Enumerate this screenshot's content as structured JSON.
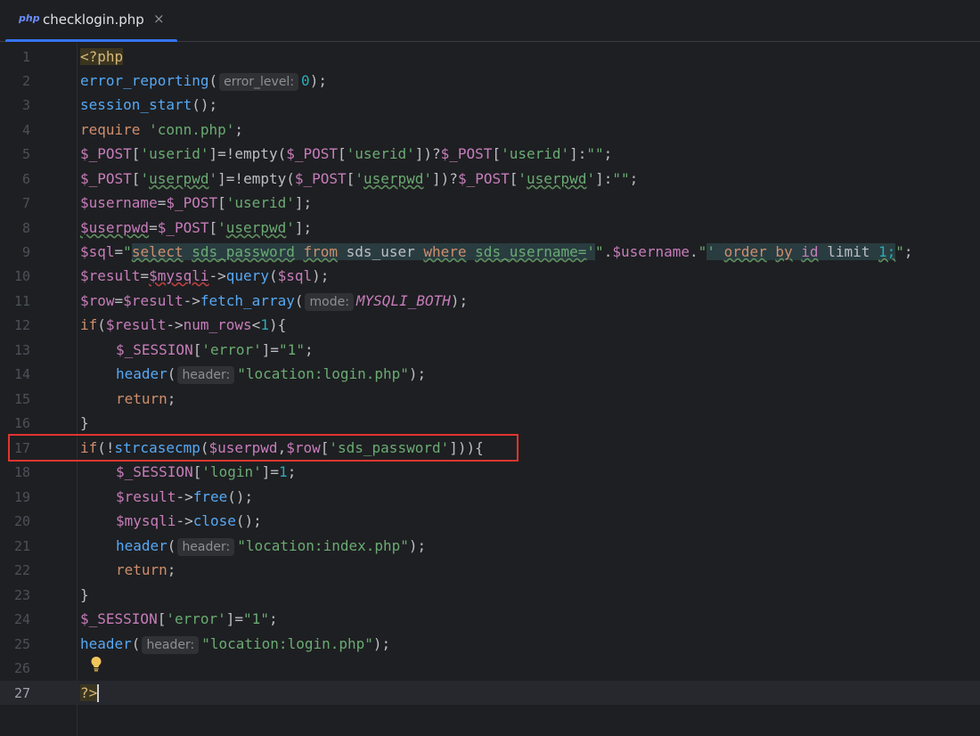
{
  "tab": {
    "icon_text": "php",
    "filename": "checklogin.php",
    "close_glyph": "×"
  },
  "hints": {
    "error_level": "error_level:",
    "mode": "mode:",
    "header": "header:"
  },
  "line_numbers": [
    "1",
    "2",
    "3",
    "4",
    "5",
    "6",
    "7",
    "8",
    "9",
    "10",
    "11",
    "12",
    "13",
    "14",
    "15",
    "16",
    "17",
    "18",
    "19",
    "20",
    "21",
    "22",
    "23",
    "24",
    "25",
    "26",
    "27"
  ],
  "code": {
    "l1": "<?php",
    "l2_fn": "error_reporting",
    "l2_arg": "0",
    "l3_fn": "session_start",
    "l4_kw": "require",
    "l4_str": "'conn.php'",
    "post": "$_POST",
    "session": "$_SESSION",
    "userid": "'userid'",
    "userpwd_q1": "'",
    "userpwd_word": "userpwd",
    "empty": "empty",
    "emptystr": "\"\"",
    "username": "$username",
    "userpwd_var": "$userpwd",
    "sql_var": "$sql",
    "result_var": "$result",
    "mysqli_var": "$mysqli",
    "row_var": "$row",
    "query_fn": "query",
    "fetch_fn": "fetch_array",
    "mysqli_both": "MYSQLI_BOTH",
    "num_rows": "num_rows",
    "one": "1",
    "error_key": "'error'",
    "one_str": "\"1\"",
    "header_fn": "header",
    "login_loc": "\"location:login.php\"",
    "index_loc": "\"location:index.php\"",
    "return_kw": "return",
    "if_kw": "if",
    "strcasecmp_fn": "strcasecmp",
    "sds_password_key": "'sds_password'",
    "login_key": "'login'",
    "free_fn": "free",
    "close_fn": "close",
    "end_tag": "?>",
    "sql_select": "select",
    "sql_col": "sds_password",
    "sql_from": "from",
    "sql_table": "sds_user",
    "sql_where": "where",
    "sql_cond": "sds_username=",
    "sql_order": "order",
    "sql_by": "by",
    "sql_id": "id",
    "sql_limit": "limit",
    "sql_limit_n": "1;"
  },
  "colors": {
    "background": "#1e1f22",
    "keyword": "#cf8e6d",
    "function": "#56a8f5",
    "variable": "#c77dbb",
    "string": "#6aab73",
    "number": "#2aacb8",
    "highlight_box": "#e0352f",
    "tab_accent": "#3574f0"
  },
  "icons": {
    "intention_bulb": "lightbulb-icon"
  }
}
